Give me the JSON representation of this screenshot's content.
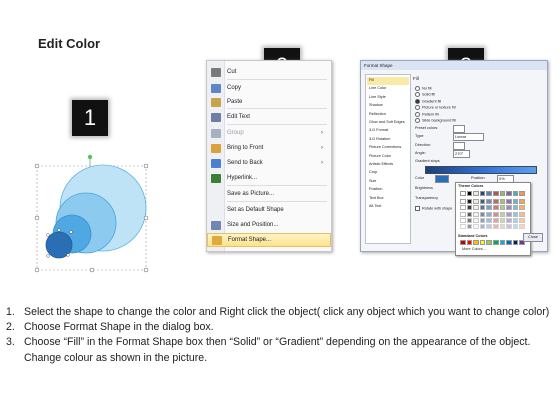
{
  "title": "Edit Color",
  "steps": {
    "one": "1",
    "two": "2",
    "three": "3"
  },
  "menu": {
    "items": [
      {
        "label": "Cut",
        "icon": "scissors-icon",
        "color": "#7a7a7a",
        "disabled": false,
        "submenu": false
      },
      {
        "label": "Copy",
        "icon": "copy-icon",
        "color": "#5f86c8",
        "disabled": false,
        "submenu": false
      },
      {
        "label": "Paste",
        "icon": "paste-icon",
        "color": "#c9a34a",
        "disabled": false,
        "submenu": false
      },
      {
        "label": "Edit Text",
        "icon": "edit-text-icon",
        "color": "#6b7fa6",
        "disabled": false,
        "submenu": false
      },
      {
        "label": "Group",
        "icon": "group-icon",
        "color": "#a7b0c0",
        "disabled": true,
        "submenu": true
      },
      {
        "label": "Bring to Front",
        "icon": "bring-to-front-icon",
        "color": "#d9a23a",
        "disabled": false,
        "submenu": true
      },
      {
        "label": "Send to Back",
        "icon": "send-to-back-icon",
        "color": "#4c7fcf",
        "disabled": false,
        "submenu": true
      },
      {
        "label": "Hyperlink...",
        "icon": "hyperlink-icon",
        "color": "#3c7d3c",
        "disabled": false,
        "submenu": false
      },
      {
        "label": "Save as Picture...",
        "icon": "",
        "color": "",
        "disabled": false,
        "submenu": false
      },
      {
        "label": "Set as Default Shape",
        "icon": "",
        "color": "",
        "disabled": false,
        "submenu": false
      },
      {
        "label": "Size and Position...",
        "icon": "size-position-icon",
        "color": "#6f86b0",
        "disabled": false,
        "submenu": false
      },
      {
        "label": "Format Shape...",
        "icon": "format-shape-icon",
        "color": "#e0a93c",
        "disabled": false,
        "submenu": false,
        "highlighted": true
      }
    ]
  },
  "dialog": {
    "title": "Format Shape",
    "sidebar": [
      "Fill",
      "Line Color",
      "Line Style",
      "Shadow",
      "Reflection",
      "Glow and Soft Edges",
      "3-D Format",
      "3-D Rotation",
      "Picture Corrections",
      "Picture Color",
      "Artistic Effects",
      "Crop",
      "Size",
      "Position",
      "Text Box",
      "Alt Text"
    ],
    "section": "Fill",
    "options": [
      "No fill",
      "Solid fill",
      "Gradient fill",
      "Picture or texture fill",
      "Pattern fill",
      "Slide background fill"
    ],
    "fields": {
      "preset": "Preset colors:",
      "type": "Type:",
      "type_value": "Linear",
      "direction": "Direction:",
      "angle": "Angle:",
      "angle_value": "270°",
      "stops": "Gradient stops",
      "color": "Color",
      "position": "Position:",
      "position_value": "0%",
      "brightness": "Brightness",
      "transparency": "Transparency",
      "rotate": "Rotate with shape"
    },
    "palette": {
      "theme": "Theme Colors",
      "standard": "Standard Colors",
      "more": "More Colors..."
    },
    "close": "Close"
  },
  "instructions": [
    {
      "num": "1.",
      "text": "Select the shape to change the color and Right click the object( click any object which you want to change color)"
    },
    {
      "num": "2.",
      "text": "Choose Format Shape in the dialog box."
    },
    {
      "num": "3.",
      "text": "Choose “Fill” in the Format Shape box then “Solid” or “Gradient” depending on the appearance of the object. Change colour as shown in the picture."
    }
  ],
  "colors": {
    "accent": "#5bb3e6",
    "shape_dark": "#2a6fb5",
    "highlight": "#fde28a"
  }
}
